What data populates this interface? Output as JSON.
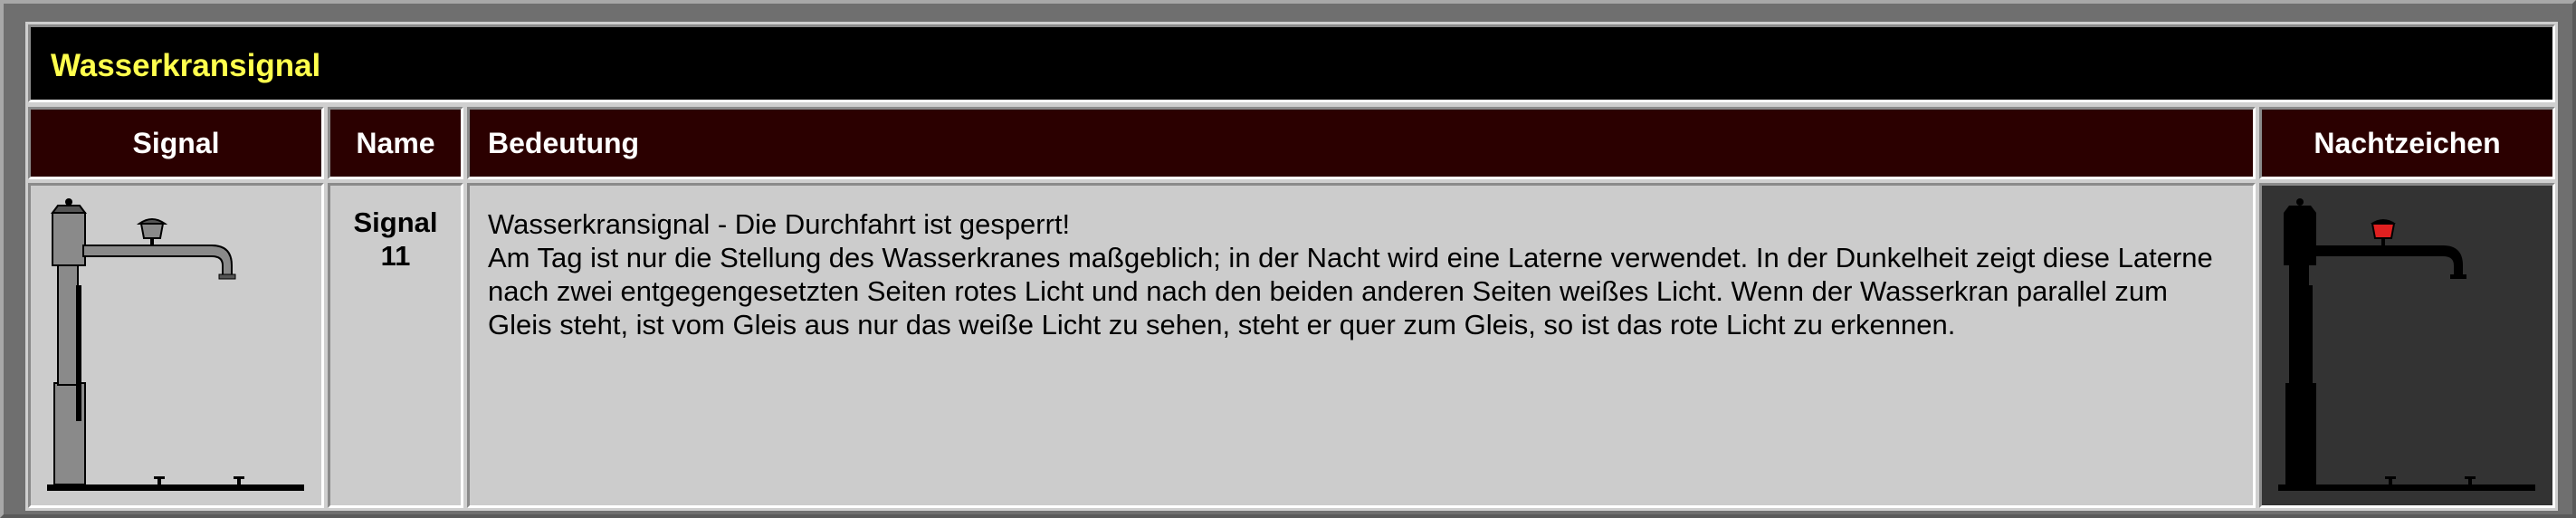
{
  "table": {
    "title": "Wasserkransignal",
    "headers": {
      "signal": "Signal",
      "name": "Name",
      "meaning": "Bedeutung",
      "night": "Nachtzeichen"
    },
    "row": {
      "name_line1": "Signal",
      "name_line2": "11",
      "meaning_line1": "Wasserkransignal - Die Durchfahrt ist gesperrt!",
      "meaning_body": "Am Tag ist nur die Stellung des Wasserkranes maßgeblich; in der Nacht wird eine Laterne verwendet. In der Dunkelheit zeigt diese Laterne nach zwei entgegengesetzten Seiten rotes Licht und nach den beiden anderen Seiten weißes Licht. Wenn der Wasserkran parallel zum Gleis steht, ist vom Gleis aus nur das weiße Licht zu sehen, steht er quer zum Gleis, so ist das rote Licht zu erkennen."
    }
  },
  "images": {
    "day": "water-crane-day-icon",
    "night": "water-crane-night-icon"
  },
  "colors": {
    "title_text": "#ffff4d",
    "header_bg": "#2b0000",
    "night_lamp": "#e02020"
  }
}
